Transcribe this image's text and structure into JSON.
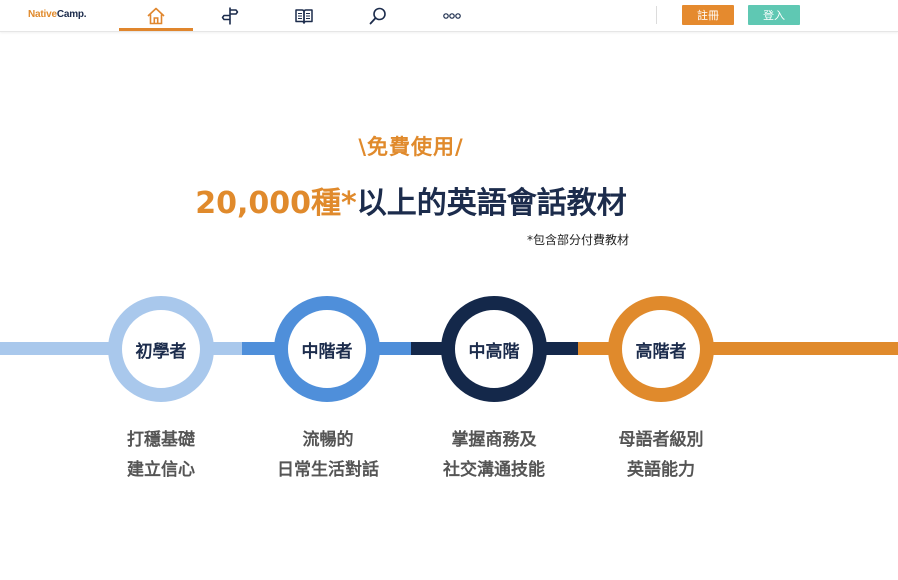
{
  "nav": {
    "logo_part1": "Native",
    "logo_part2": "Camp.",
    "items": [
      {
        "icon": "home-icon",
        "active": true
      },
      {
        "icon": "signpost-icon",
        "active": false
      },
      {
        "icon": "book-icon",
        "active": false
      },
      {
        "icon": "search-icon",
        "active": false
      },
      {
        "icon": "more-icon",
        "active": false
      }
    ],
    "register_label": "註冊",
    "login_label": "登入"
  },
  "hero": {
    "free_label": "\\免費使用/",
    "headline_accent": "20,000種*",
    "headline_main": "以上的英語會話教材",
    "note": "*包含部分付費教材"
  },
  "levels": [
    {
      "name": "初學者",
      "desc1": "打穩基礎",
      "desc2": "建立信心",
      "color": "#a9c8ec"
    },
    {
      "name": "中階者",
      "desc1": "流暢的",
      "desc2": "日常生活對話",
      "color": "#4f8fda"
    },
    {
      "name": "中高階",
      "desc1": "掌握商務及",
      "desc2": "社交溝通技能",
      "color": "#14284a"
    },
    {
      "name": "高階者",
      "desc1": "母語者級別",
      "desc2": "英語能力",
      "color": "#e08a2c"
    }
  ],
  "colors": {
    "accent_orange": "#e08a2c",
    "navy": "#1c2c4c",
    "login_teal": "#5fc8b3"
  }
}
